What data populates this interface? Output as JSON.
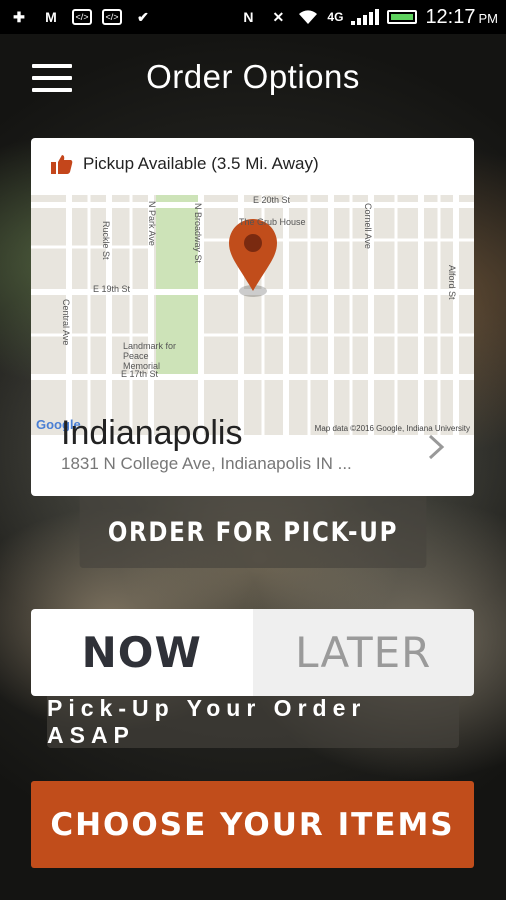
{
  "status_bar": {
    "time": "12:17",
    "ampm": "PM",
    "network": "4G"
  },
  "header": {
    "title": "Order Options"
  },
  "location": {
    "availability": "Pickup Available (3.5 Mi. Away)",
    "city": "Indianapolis",
    "address": "1831 N College Ave, Indianapolis IN ...",
    "map": {
      "streets": [
        "E 20th St",
        "E 19th St",
        "E 17th St",
        "N Park Ave",
        "N Broadway St",
        "Central Ave",
        "Ruckle St",
        "Cornell Ave",
        "Alford St"
      ],
      "places": [
        "The Grub House",
        "Landmark for Peace Memorial"
      ],
      "attribution": "Map data ©2016 Google, Indiana University",
      "logo": "Google"
    }
  },
  "order_type_button": "ORDER FOR PICK-UP",
  "timing": {
    "now_label": "NOW",
    "later_label": "LATER",
    "selected": "NOW",
    "description": "Pick-Up Your Order ASAP"
  },
  "cta": {
    "label": "CHOOSE YOUR ITEMS"
  },
  "colors": {
    "accent": "#c14d1b",
    "thumb": "#c4461b"
  }
}
